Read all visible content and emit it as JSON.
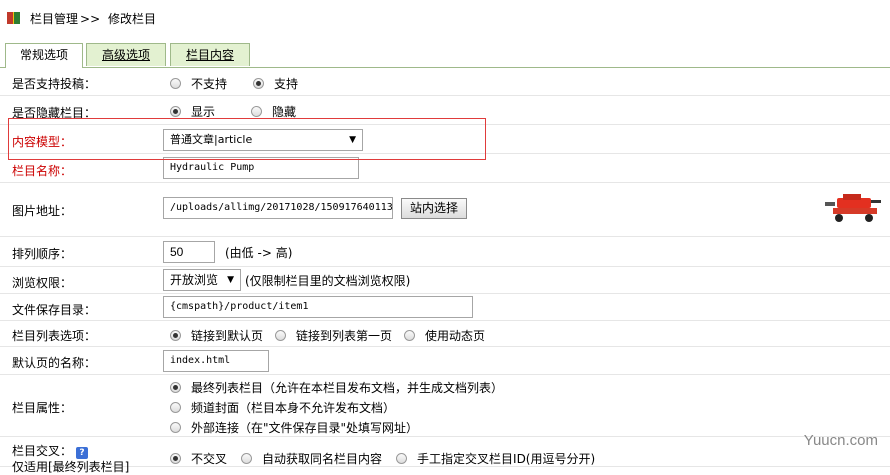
{
  "breadcrumb": {
    "section": "栏目管理",
    "separator": ">>",
    "current": "修改栏目"
  },
  "tabs": [
    {
      "label": "常规选项"
    },
    {
      "label": "高级选项"
    },
    {
      "label": "栏目内容"
    }
  ],
  "form": {
    "contribute": {
      "label": "是否支持投稿：",
      "options": [
        "不支持",
        "支持"
      ],
      "selected": 1
    },
    "hidden": {
      "label": "是否隐藏栏目：",
      "options": [
        "显示",
        "隐藏"
      ],
      "selected": 0
    },
    "model": {
      "label": "内容模型：",
      "value": "普通文章|article"
    },
    "name": {
      "label": "栏目名称：",
      "value": "Hydraulic Pump"
    },
    "image": {
      "label": "图片地址：",
      "value": "/uploads/allimg/20171028/15091764011З",
      "button": "站内选择"
    },
    "sort": {
      "label": "排列顺序：",
      "value": "50",
      "hint": "(由低 -> 高)"
    },
    "browse": {
      "label": "浏览权限：",
      "value": "开放浏览",
      "hint": "(仅限制栏目里的文档浏览权限)"
    },
    "savedir": {
      "label": "文件保存目录：",
      "value": "{cmspath}/product/item1"
    },
    "listopt": {
      "label": "栏目列表选项：",
      "options": [
        "链接到默认页",
        "链接到列表第一页",
        "使用动态页"
      ],
      "selected": 0
    },
    "defaultpage": {
      "label": "默认页的名称：",
      "value": "index.html"
    },
    "attr": {
      "label": "栏目属性：",
      "options": [
        "最终列表栏目（允许在本栏目发布文档，并生成文档列表）",
        "频道封面（栏目本身不允许发布文档）",
        "外部连接（在\"文件保存目录\"处填写网址）"
      ],
      "selected": 0
    },
    "cross": {
      "label": "栏目交叉：",
      "help": "?",
      "sublabel": "仅适用[最终列表栏目]",
      "options": [
        "不交叉",
        "自动获取同名栏目内容",
        "手工指定交叉栏目ID(用逗号分开)"
      ],
      "selected": 0
    }
  },
  "watermark": "Yuucn.com",
  "colors": {
    "tab_green": "#e3f1d1",
    "required_label": "#cc0000",
    "highlight_border": "#e03b3b"
  }
}
